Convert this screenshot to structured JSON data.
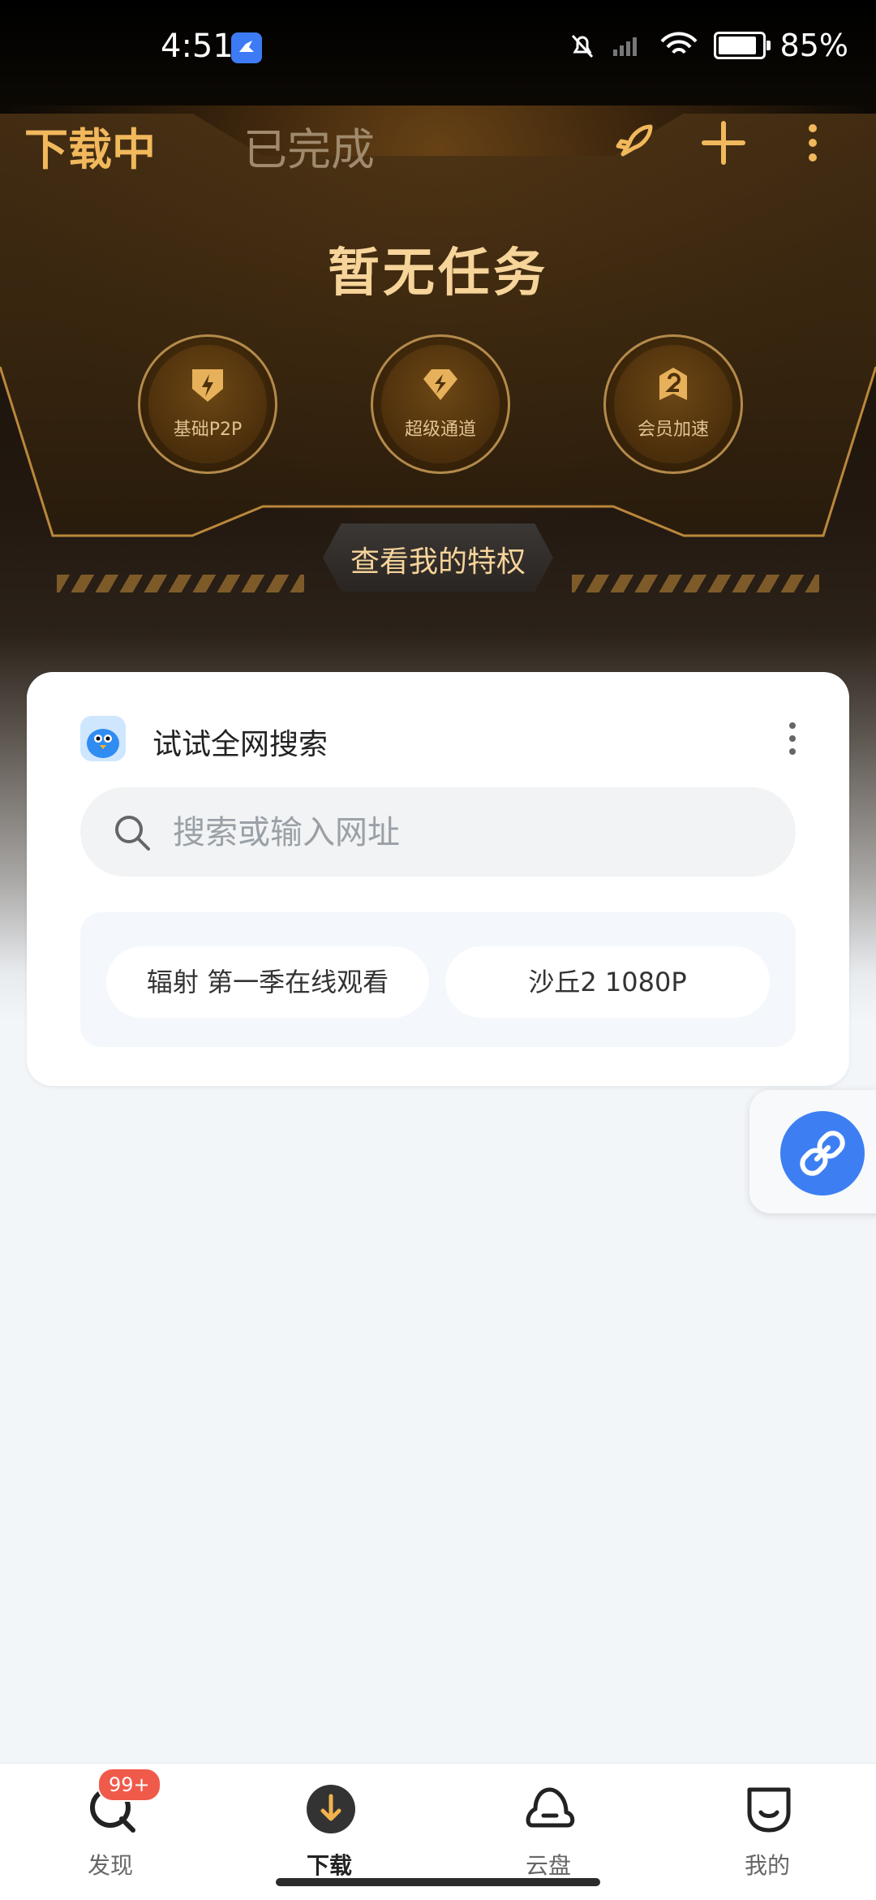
{
  "status_bar": {
    "time": "4:51",
    "battery": "85%"
  },
  "top_nav": {
    "tabs": [
      {
        "label": "下载中",
        "active": true
      },
      {
        "label": "已完成",
        "active": false
      }
    ],
    "icons": [
      "rocket-icon",
      "plus-icon",
      "more-vertical-icon"
    ]
  },
  "hero": {
    "headline": "暂无任务",
    "features": [
      {
        "label": "基础P2P",
        "icon": "p2p-shield-icon"
      },
      {
        "label": "超级通道",
        "icon": "super-channel-icon"
      },
      {
        "label": "会员加速",
        "icon": "member-speed-icon"
      }
    ],
    "privilege_button": "查看我的特权"
  },
  "search_card": {
    "title": "试试全网搜索",
    "search_placeholder": "搜索或输入网址",
    "suggestions": [
      "辐射 第一季在线观看",
      "沙丘2 1080P"
    ]
  },
  "bottom_nav": {
    "items": [
      {
        "label": "发现",
        "icon": "discover-icon",
        "badge": "99+"
      },
      {
        "label": "下载",
        "icon": "download-icon",
        "active": true
      },
      {
        "label": "云盘",
        "icon": "cloud-icon"
      },
      {
        "label": "我的",
        "icon": "profile-icon"
      }
    ]
  },
  "colors": {
    "accent_gold": "#f1b85c",
    "link_blue": "#3d7ff2",
    "badge_red": "#f05a4a"
  }
}
